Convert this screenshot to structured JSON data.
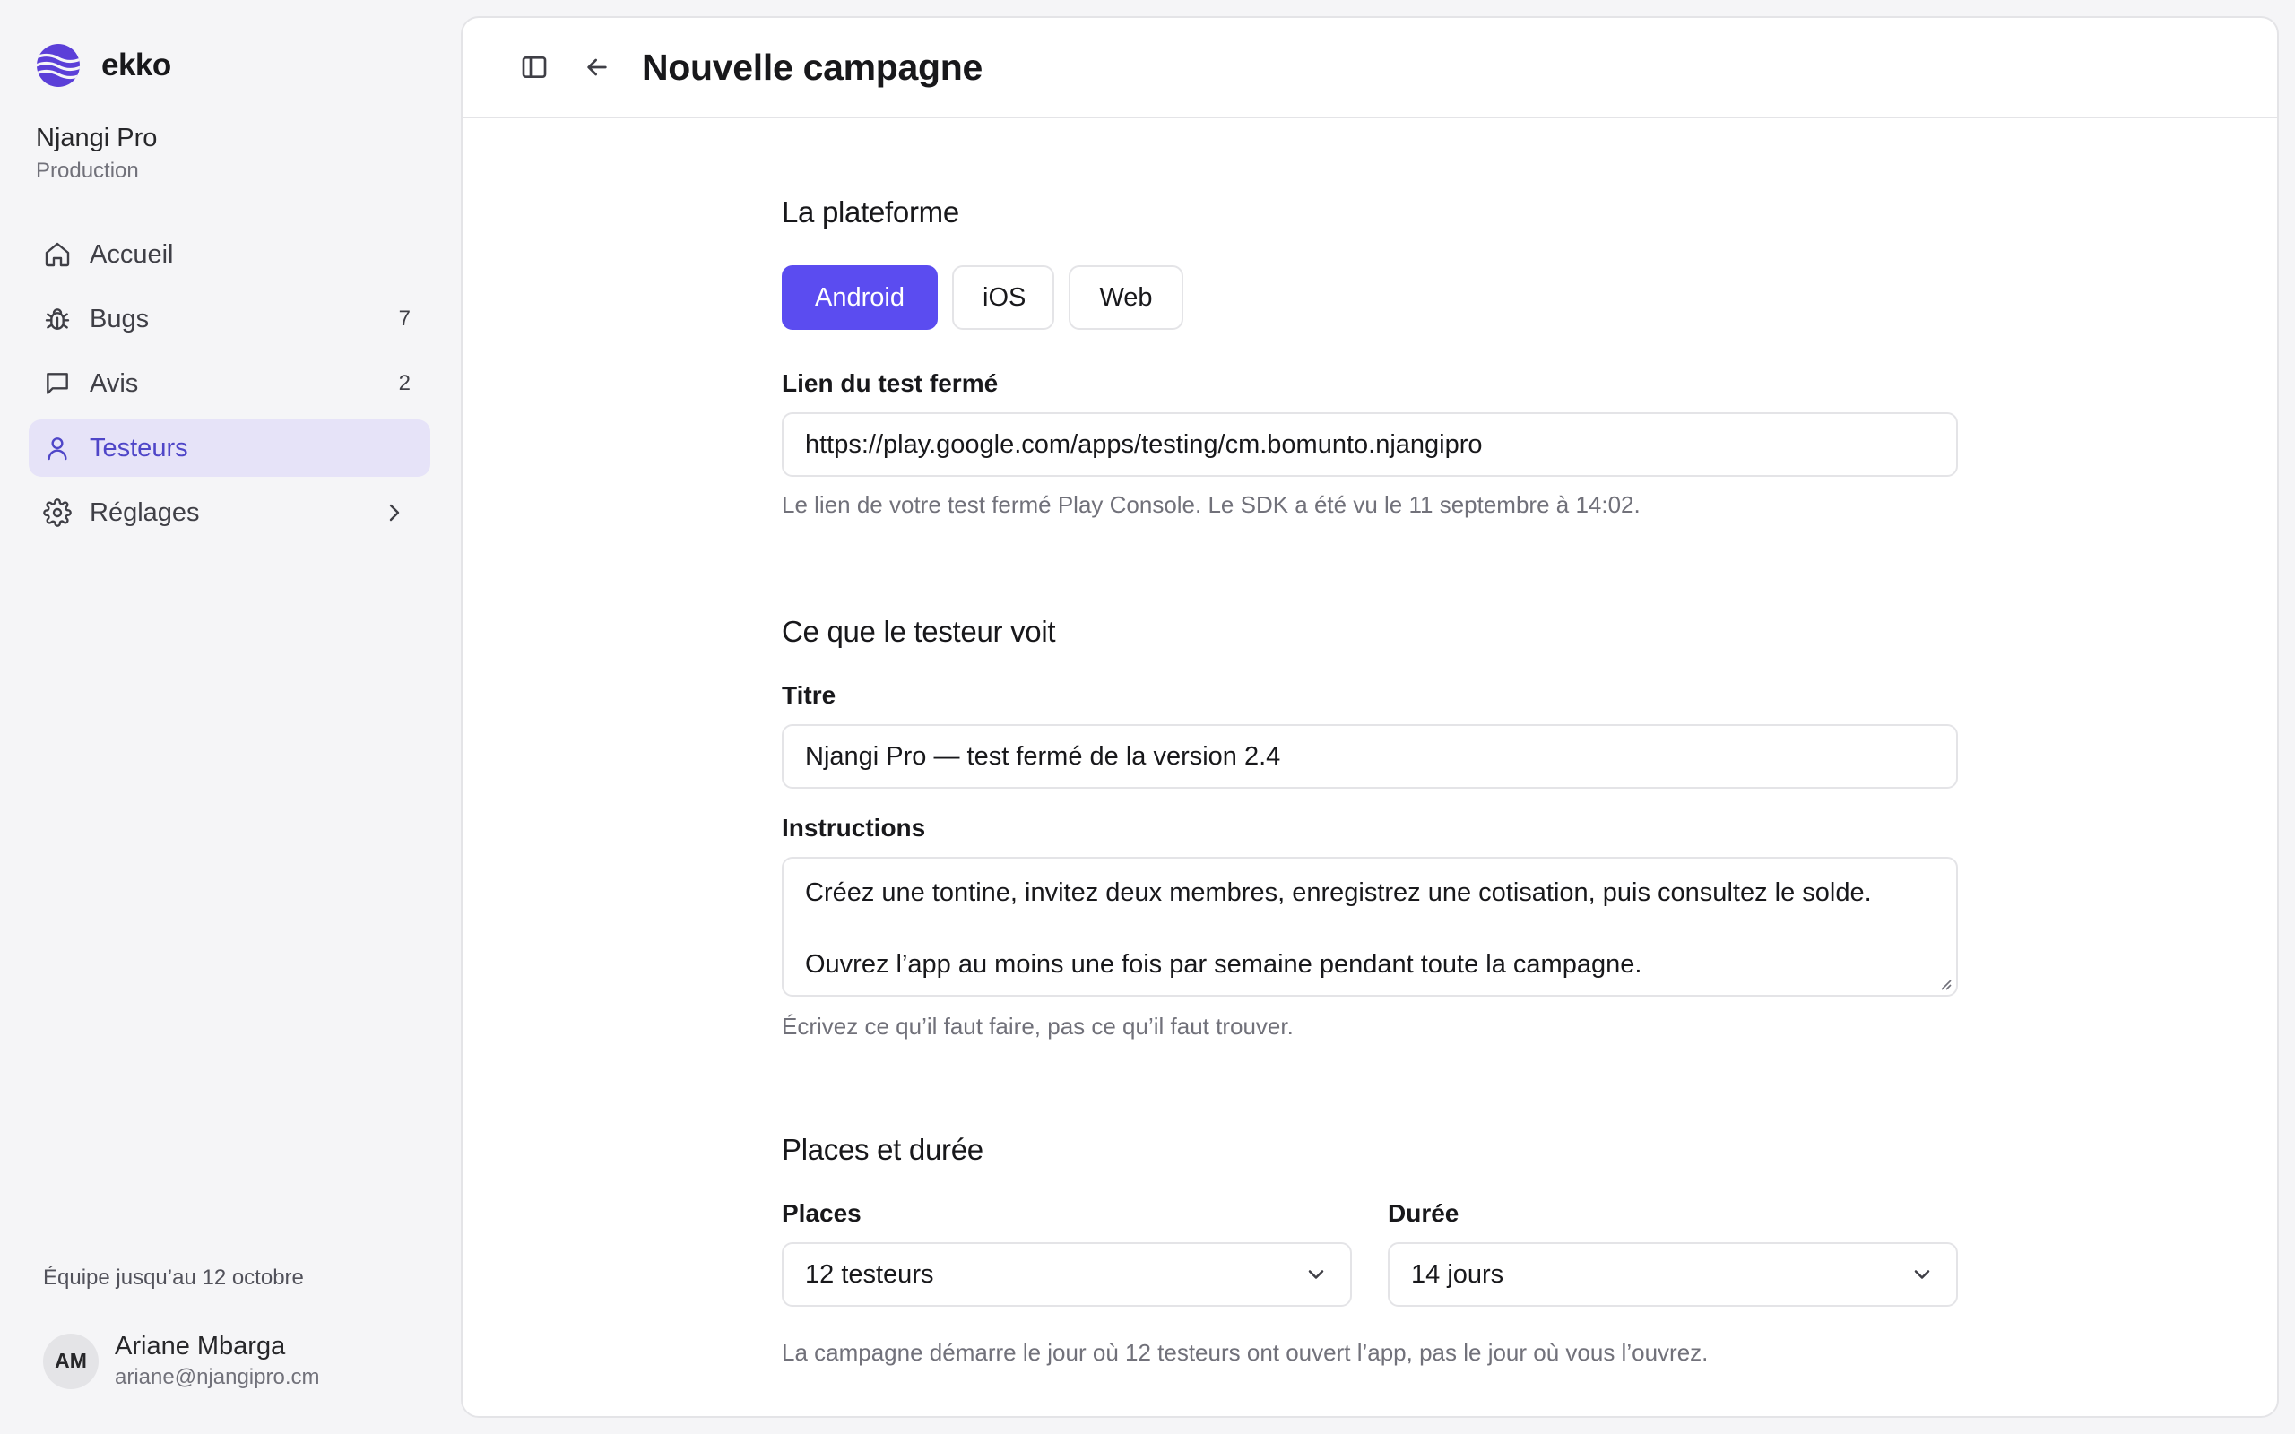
{
  "brand": {
    "name": "ekko",
    "accent": "#5b4cf0"
  },
  "org": {
    "name": "Njangi Pro",
    "env": "Production"
  },
  "nav": [
    {
      "label": "Accueil",
      "icon": "home-icon",
      "count": ""
    },
    {
      "label": "Bugs",
      "icon": "bug-icon",
      "count": "7"
    },
    {
      "label": "Avis",
      "icon": "message-icon",
      "count": "2"
    },
    {
      "label": "Testeurs",
      "icon": "user-icon",
      "count": "",
      "active": true
    },
    {
      "label": "Réglages",
      "icon": "gear-icon",
      "count": ""
    }
  ],
  "team_note": "Équipe jusqu’au 12 octobre",
  "user": {
    "initials": "AM",
    "name": "Ariane Mbarga",
    "email": "ariane@njangipro.cm"
  },
  "header": {
    "title": "Nouvelle campagne"
  },
  "platform": {
    "title": "La plateforme",
    "options": [
      "Android",
      "iOS",
      "Web"
    ],
    "selected": "Android"
  },
  "link": {
    "label": "Lien du test fermé",
    "value": "https://play.google.com/apps/testing/cm.bomunto.njangipro",
    "hint": "Le lien de votre test fermé Play Console. Le SDK a été vu le 11 septembre à 14:02."
  },
  "tester_view": {
    "title": "Ce que le testeur voit",
    "title_label": "Titre",
    "title_value": "Njangi Pro — test fermé de la version 2.4",
    "instructions_label": "Instructions",
    "instructions_lines": [
      "Créez une tontine, invitez deux membres, enregistrez une cotisation, puis consultez le solde.",
      "Ouvrez l’app au moins une fois par semaine pendant toute la campagne."
    ],
    "instructions_hint": "Écrivez ce qu’il faut faire, pas ce qu’il faut trouver."
  },
  "places": {
    "title": "Places et durée",
    "places_label": "Places",
    "places_value": "12 testeurs",
    "duration_label": "Durée",
    "duration_value": "14 jours",
    "hint": "La campagne démarre le jour où 12 testeurs ont ouvert l’app, pas le jour où vous l’ouvrez."
  }
}
